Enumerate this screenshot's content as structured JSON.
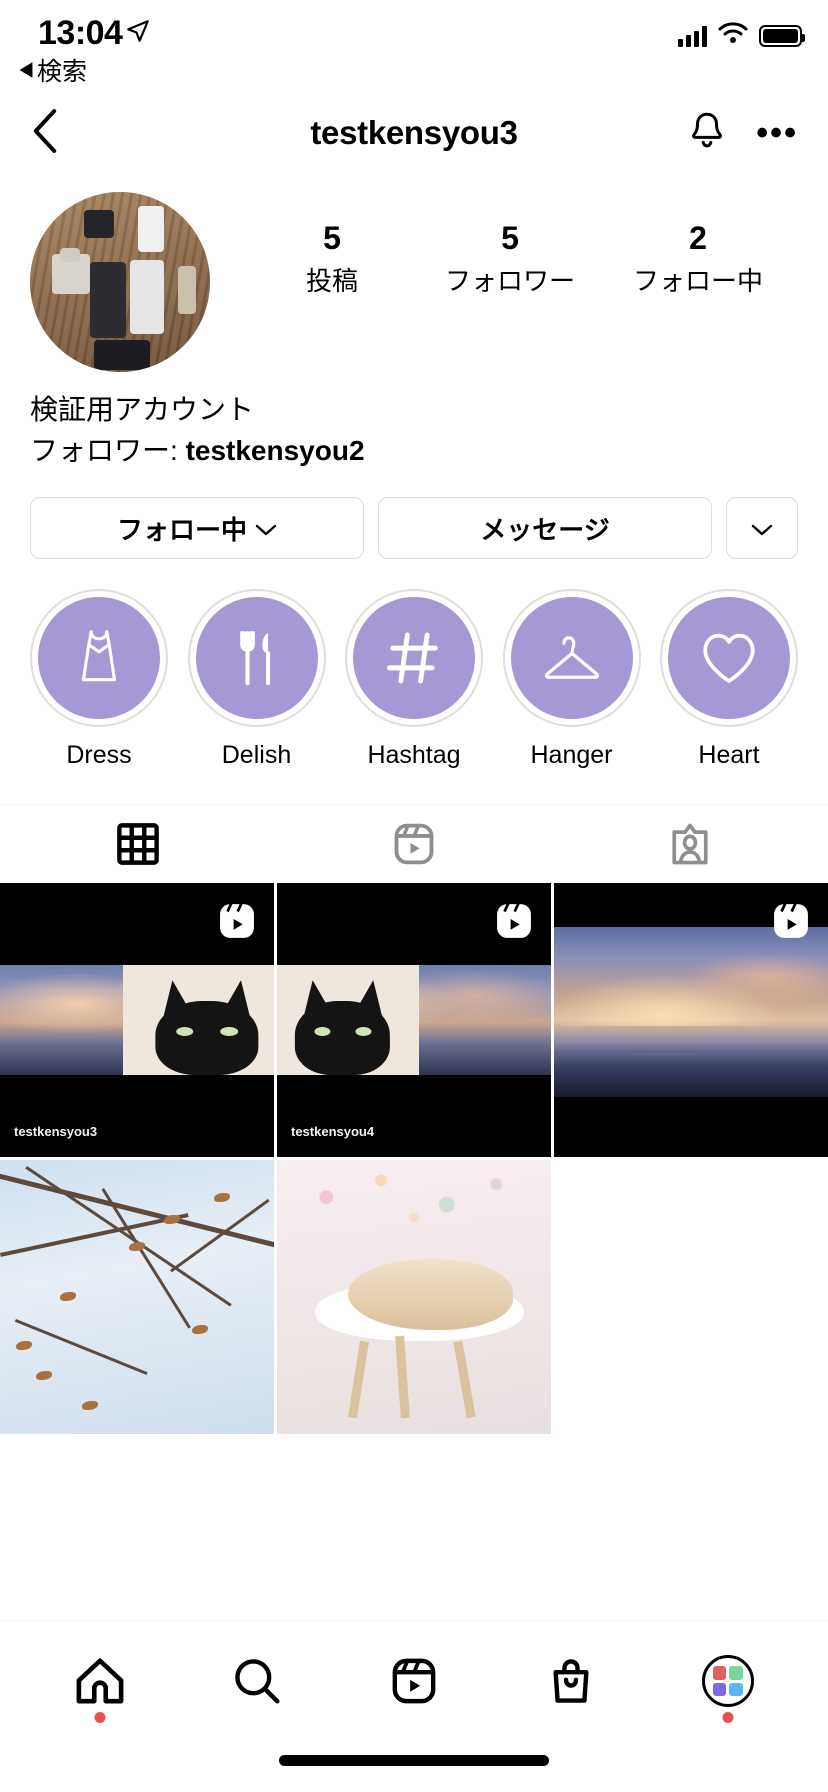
{
  "status_bar": {
    "time": "13:04",
    "back_label": "検索",
    "location_icon": "location-arrow-icon",
    "signal_icon": "cellular-signal-icon",
    "wifi_icon": "wifi-icon",
    "battery_icon": "battery-full-icon"
  },
  "nav": {
    "back_icon": "chevron-left-icon",
    "title": "testkensyou3",
    "bell_icon": "notification-bell-icon",
    "more_label": "•••"
  },
  "profile": {
    "avatar_alt": "profile-photo-flatlay-devices",
    "stats": [
      {
        "num": "5",
        "label": "投稿"
      },
      {
        "num": "5",
        "label": "フォロワー"
      },
      {
        "num": "2",
        "label": "フォロー中"
      }
    ],
    "bio_name": "検証用アカウント",
    "follower_prefix": "フォロワー: ",
    "follower_name": "testkensyou2"
  },
  "actions": {
    "following_label": "フォロー中",
    "following_chevron": "⌄",
    "message_label": "メッセージ",
    "more_chevron": "⌄"
  },
  "highlights": [
    {
      "label": "Dress",
      "icon": "dress-icon"
    },
    {
      "label": "Delish",
      "icon": "fork-knife-icon"
    },
    {
      "label": "Hashtag",
      "icon": "hashtag-icon"
    },
    {
      "label": "Hanger",
      "icon": "clothes-hanger-icon"
    },
    {
      "label": "Heart",
      "icon": "heart-icon"
    }
  ],
  "highlight_colors": {
    "fill": "#a598d4",
    "ring": "#dedede",
    "glyph": "#ffffff"
  },
  "tabs": [
    {
      "name": "grid-tab",
      "icon": "grid-icon",
      "active": true
    },
    {
      "name": "reels-tab",
      "icon": "reels-icon",
      "active": false
    },
    {
      "name": "tagged-tab",
      "icon": "tagged-person-icon",
      "active": false
    }
  ],
  "grid_posts": [
    {
      "kind": "reel-letterbox-cat",
      "badge": "reels-icon",
      "watermark": "testkensyou3"
    },
    {
      "kind": "reel-letterbox-cat",
      "badge": "reels-icon",
      "watermark": "testkensyou4"
    },
    {
      "kind": "reel-sunset",
      "badge": "reels-icon",
      "watermark": ""
    },
    {
      "kind": "photo-branches",
      "badge": "",
      "watermark": ""
    },
    {
      "kind": "photo-sleeping-cat",
      "badge": "",
      "watermark": ""
    },
    {
      "kind": "empty",
      "badge": "",
      "watermark": ""
    }
  ],
  "bottom_nav": [
    {
      "name": "home",
      "icon": "home-icon",
      "dot": true
    },
    {
      "name": "search",
      "icon": "search-icon",
      "dot": false
    },
    {
      "name": "reels",
      "icon": "reels-icon",
      "dot": false
    },
    {
      "name": "shop",
      "icon": "shopping-bag-icon",
      "dot": false
    },
    {
      "name": "profile",
      "icon": "profile-avatar-icon",
      "dot": true
    }
  ],
  "bottom_nav_avatar_colors": [
    "#e0615c",
    "#7bd49a",
    "#7c6ae0",
    "#5ab7ef"
  ],
  "accent_colors": {
    "notification_dot": "#e8524a",
    "highlight_purple": "#a598d4",
    "tab_active": "#000000",
    "tab_inactive": "#8e8e8e"
  }
}
